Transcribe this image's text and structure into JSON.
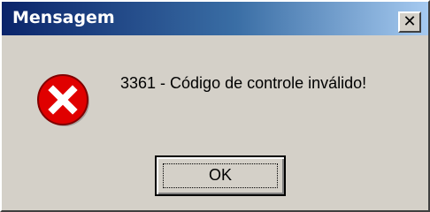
{
  "window": {
    "title": "Mensagem",
    "close_label": "✕"
  },
  "dialog": {
    "icon": "error-icon",
    "message": "3361 - Código de controle inválido!",
    "ok_label": "OK"
  },
  "colors": {
    "titlebar_start": "#0a246a",
    "titlebar_end": "#a6caf0",
    "error_red": "#e00000",
    "face": "#d4d0c8"
  }
}
